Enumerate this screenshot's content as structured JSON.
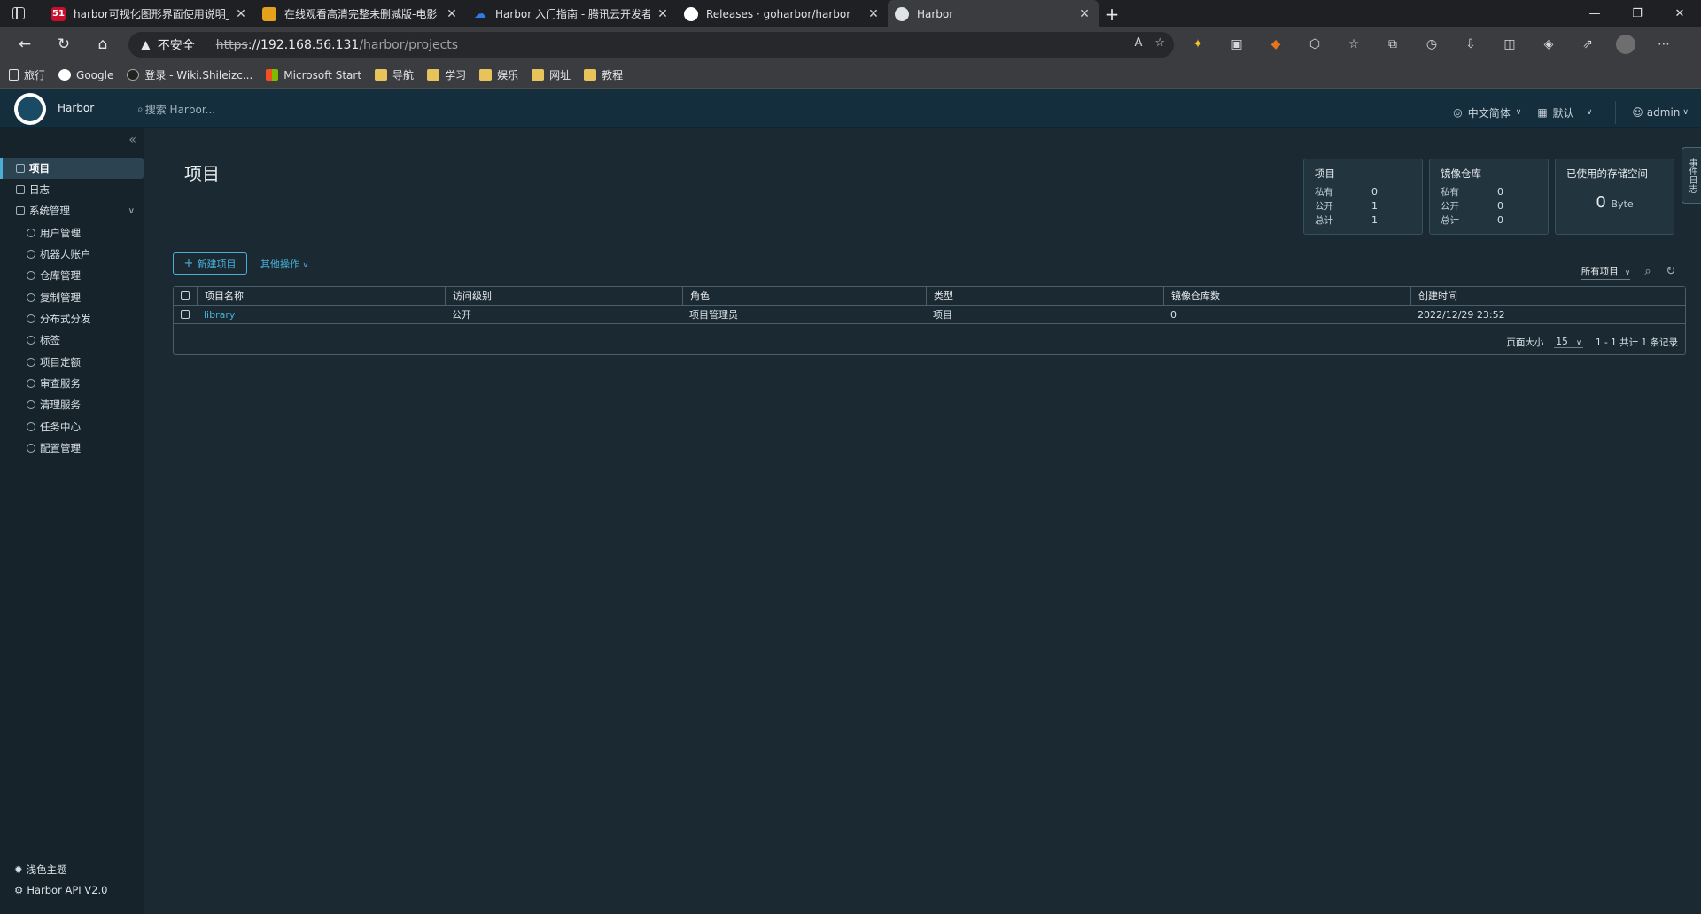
{
  "browser": {
    "tabs": [
      {
        "title": "harbor可视化图形界面使用说明_",
        "fav_text": "51",
        "fav_color": "#c8102e"
      },
      {
        "title": "在线观看高清完整未删减版-电影",
        "fav_text": "",
        "fav_color": "#e4a11b"
      },
      {
        "title": "Harbor 入门指南 - 腾讯云开发者",
        "fav_text": "",
        "fav_color": "#2f7ae5"
      },
      {
        "title": "Releases · goharbor/harbor",
        "fav_text": "",
        "fav_color": "#ffffff"
      },
      {
        "title": "Harbor",
        "fav_text": "",
        "fav_color": "#dfe3e6"
      }
    ],
    "security_label": "不安全",
    "url": {
      "proto": "https",
      "host": "://192.168.56.131",
      "path": "/harbor/projects"
    },
    "bookmarks": [
      {
        "label": "旅行",
        "icon": "page-icon"
      },
      {
        "label": "Google",
        "icon": "google-icon"
      },
      {
        "label": "登录 - Wiki.Shileizc...",
        "icon": "s-icon"
      },
      {
        "label": "Microsoft Start",
        "icon": "windows-icon"
      },
      {
        "label": "导航",
        "icon": "folder-icon"
      },
      {
        "label": "学习",
        "icon": "folder-icon"
      },
      {
        "label": "娱乐",
        "icon": "folder-icon"
      },
      {
        "label": "网址",
        "icon": "folder-icon"
      },
      {
        "label": "教程",
        "icon": "folder-icon"
      }
    ]
  },
  "harbor": {
    "brand": "Harbor",
    "search_placeholder": "搜索 Harbor...",
    "language": "中文简体",
    "scheme": "默认",
    "user": "admin",
    "sidebar": {
      "items": [
        {
          "label": "项目",
          "active": true
        },
        {
          "label": "日志"
        },
        {
          "label": "系统管理"
        }
      ],
      "sub_items": [
        "用户管理",
        "机器人账户",
        "仓库管理",
        "复制管理",
        "分布式分发",
        "标签",
        "项目定额",
        "审查服务",
        "清理服务",
        "任务中心",
        "配置管理"
      ],
      "theme_toggle": "浅色主题",
      "api_link": "Harbor API V2.0"
    },
    "page_title": "项目",
    "cards": [
      {
        "title": "项目",
        "rows": [
          {
            "k": "私有",
            "v": "0"
          },
          {
            "k": "公开",
            "v": "1"
          },
          {
            "k": "总计",
            "v": "1"
          }
        ]
      },
      {
        "title": "镜像仓库",
        "rows": [
          {
            "k": "私有",
            "v": "0"
          },
          {
            "k": "公开",
            "v": "0"
          },
          {
            "k": "总计",
            "v": "0"
          }
        ]
      },
      {
        "title": "已使用的存储空间",
        "value": "0",
        "unit": "Byte"
      }
    ],
    "side_tab": "事件日志",
    "new_project": "新建项目",
    "other_actions": "其他操作",
    "filter_label": "所有项目",
    "table": {
      "columns": [
        "项目名称",
        "访问级别",
        "角色",
        "类型",
        "镜像仓库数",
        "创建时间"
      ],
      "rows": [
        {
          "name": "library",
          "access": "公开",
          "role": "项目管理员",
          "type": "项目",
          "repo_count": "0",
          "created": "2022/12/29 23:52"
        }
      ],
      "page_size_label": "页面大小",
      "page_size": "15",
      "summary": "1 - 1 共计 1 条记录"
    }
  }
}
